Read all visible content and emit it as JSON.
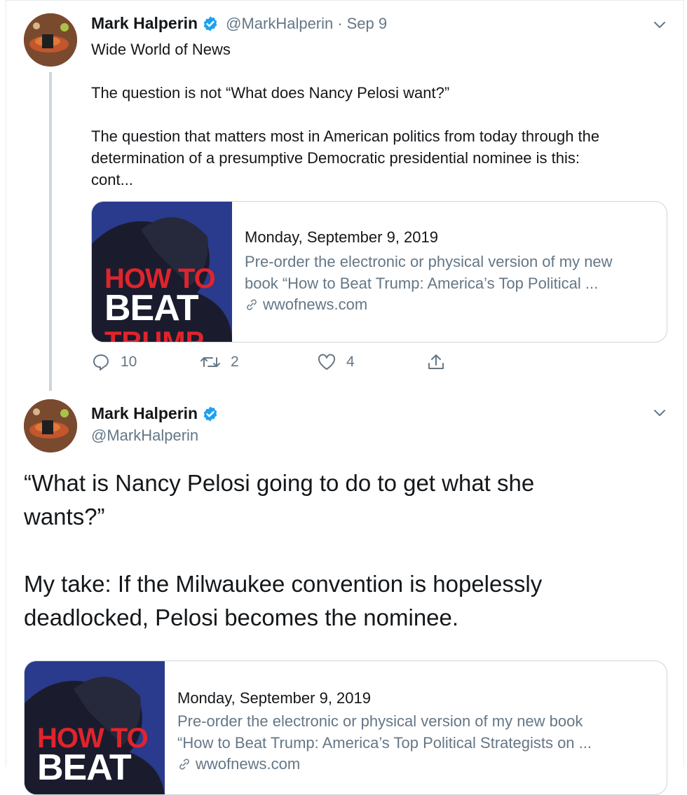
{
  "colors": {
    "accent": "#1da1f2",
    "text": "#14171a",
    "muted": "#657786",
    "border": "#ccd6dd"
  },
  "tweet1": {
    "name": "Mark Halperin",
    "handle": "@MarkHalperin",
    "separator": "·",
    "date": "Sep 9",
    "lines": [
      "Wide World of News",
      "The question is not “What does Nancy Pelosi want?”",
      "The question that matters most in American politics from today through the",
      "determination of a presumptive Democratic presidential nominee is this:",
      "cont..."
    ],
    "card": {
      "cover_line1": "HOW TO",
      "cover_line2": "BEAT",
      "cover_line3": "TRUMP",
      "title": "Monday, September 9, 2019",
      "desc_lines": [
        "Pre-order the electronic or physical version of my new",
        "book “How to Beat Trump: America’s Top Political ..."
      ],
      "domain": "wwofnews.com",
      "link_icon": "link-icon"
    },
    "actions": {
      "replies": "10",
      "retweets": "2",
      "likes": "4"
    },
    "icons": [
      "verified-badge-icon",
      "chevron-down-icon",
      "reply-icon",
      "retweet-icon",
      "like-icon",
      "share-icon"
    ]
  },
  "tweet2": {
    "name": "Mark Halperin",
    "handle": "@MarkHalperin",
    "lines": [
      "“What is Nancy Pelosi going to do to get what she",
      "wants?”",
      "My take: If the Milwaukee convention is hopelessly",
      "deadlocked, Pelosi becomes the nominee."
    ],
    "card": {
      "cover_line1": "HOW TO",
      "cover_line2": "BEAT",
      "title": "Monday, September 9, 2019",
      "desc_lines": [
        "Pre-order the electronic or physical version of my new book",
        "“How to Beat Trump: America’s Top Political Strategists on ..."
      ],
      "domain": "wwofnews.com"
    }
  }
}
